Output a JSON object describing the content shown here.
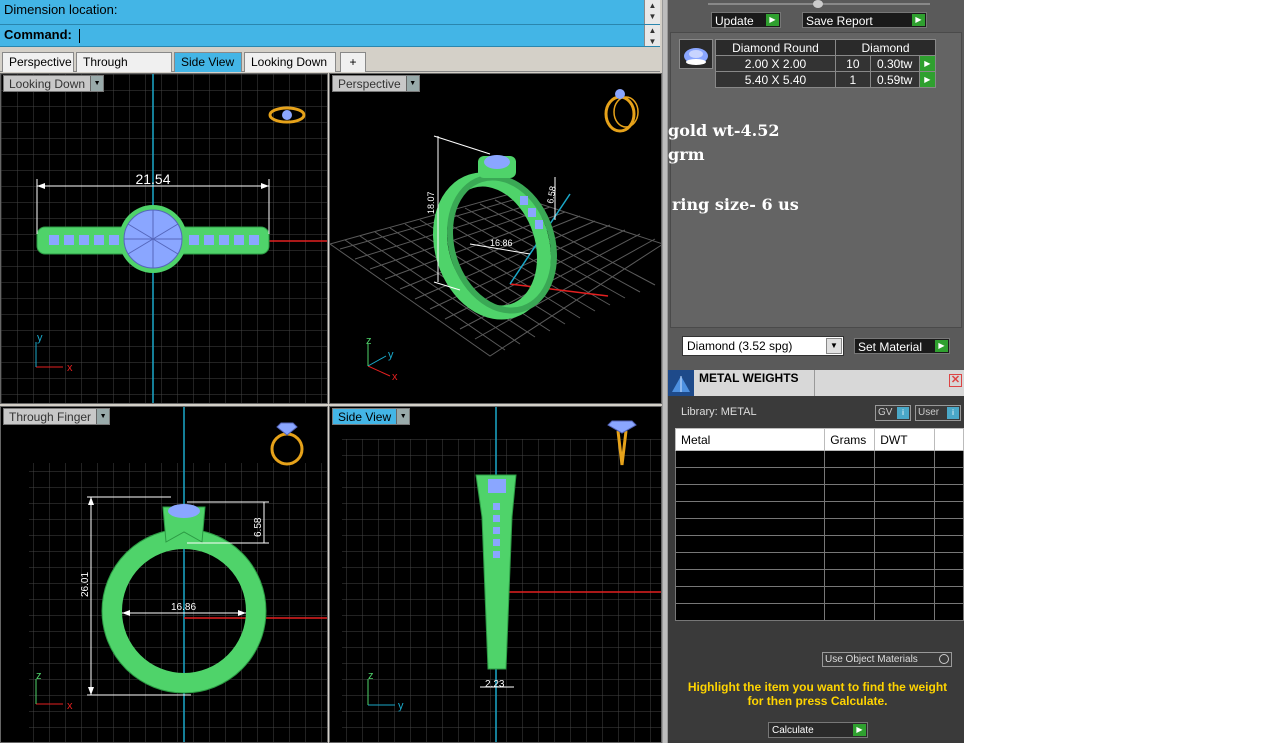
{
  "command": {
    "dimension_label": "Dimension location:",
    "command_label": "Command:"
  },
  "tabs": [
    "Perspective",
    "Through Finger",
    "Side View",
    "Looking Down",
    "+"
  ],
  "viewports": {
    "top_left": {
      "label": "Looking Down",
      "dimension": "21.54"
    },
    "top_right": {
      "label": "Perspective",
      "dim_a": "18.07",
      "dim_b": "6.58",
      "dim_c": "16.86"
    },
    "bottom_left": {
      "label": "Through Finger",
      "dim_height": "26.01",
      "dim_inner": "16.86",
      "dim_top": "6.58"
    },
    "bottom_right": {
      "label": "Side View",
      "dimension": "2.23"
    }
  },
  "axes": {
    "x": "x",
    "y": "y",
    "z": "z"
  },
  "report": {
    "update_label": "Update",
    "save_label": "Save Report"
  },
  "diamonds": {
    "headers": [
      "Diamond Round",
      "Diamond"
    ],
    "rows": [
      {
        "size": "2.00 X 2.00",
        "count": "10",
        "weight": "0.30tw"
      },
      {
        "size": "5.40 X 5.40",
        "count": "1",
        "weight": "0.59tw"
      }
    ]
  },
  "notes": {
    "gold_line1": "gold wt-4.52",
    "gold_line2": "grm",
    "ring_size": "ring size- 6 us"
  },
  "material": {
    "selected": "Diamond     (3.52 spg)",
    "set_label": "Set Material"
  },
  "metal_weights": {
    "title": "METAL WEIGHTS",
    "library": "Library: METAL",
    "gv": "GV",
    "user": "User",
    "columns": [
      "Metal",
      "Grams",
      "DWT"
    ],
    "use_object_materials": "Use Object Materials",
    "hint": "Highlight the item you want to find the weight for then press Calculate.",
    "calculate_label": "Calculate"
  },
  "colors": {
    "accent": "#43b5e6",
    "ring_green": "#4fd36a",
    "gem_blue": "#8aa6ff",
    "dim_white": "#ffffff",
    "axis_red": "#e32020",
    "hint_yellow": "#ffd400"
  }
}
